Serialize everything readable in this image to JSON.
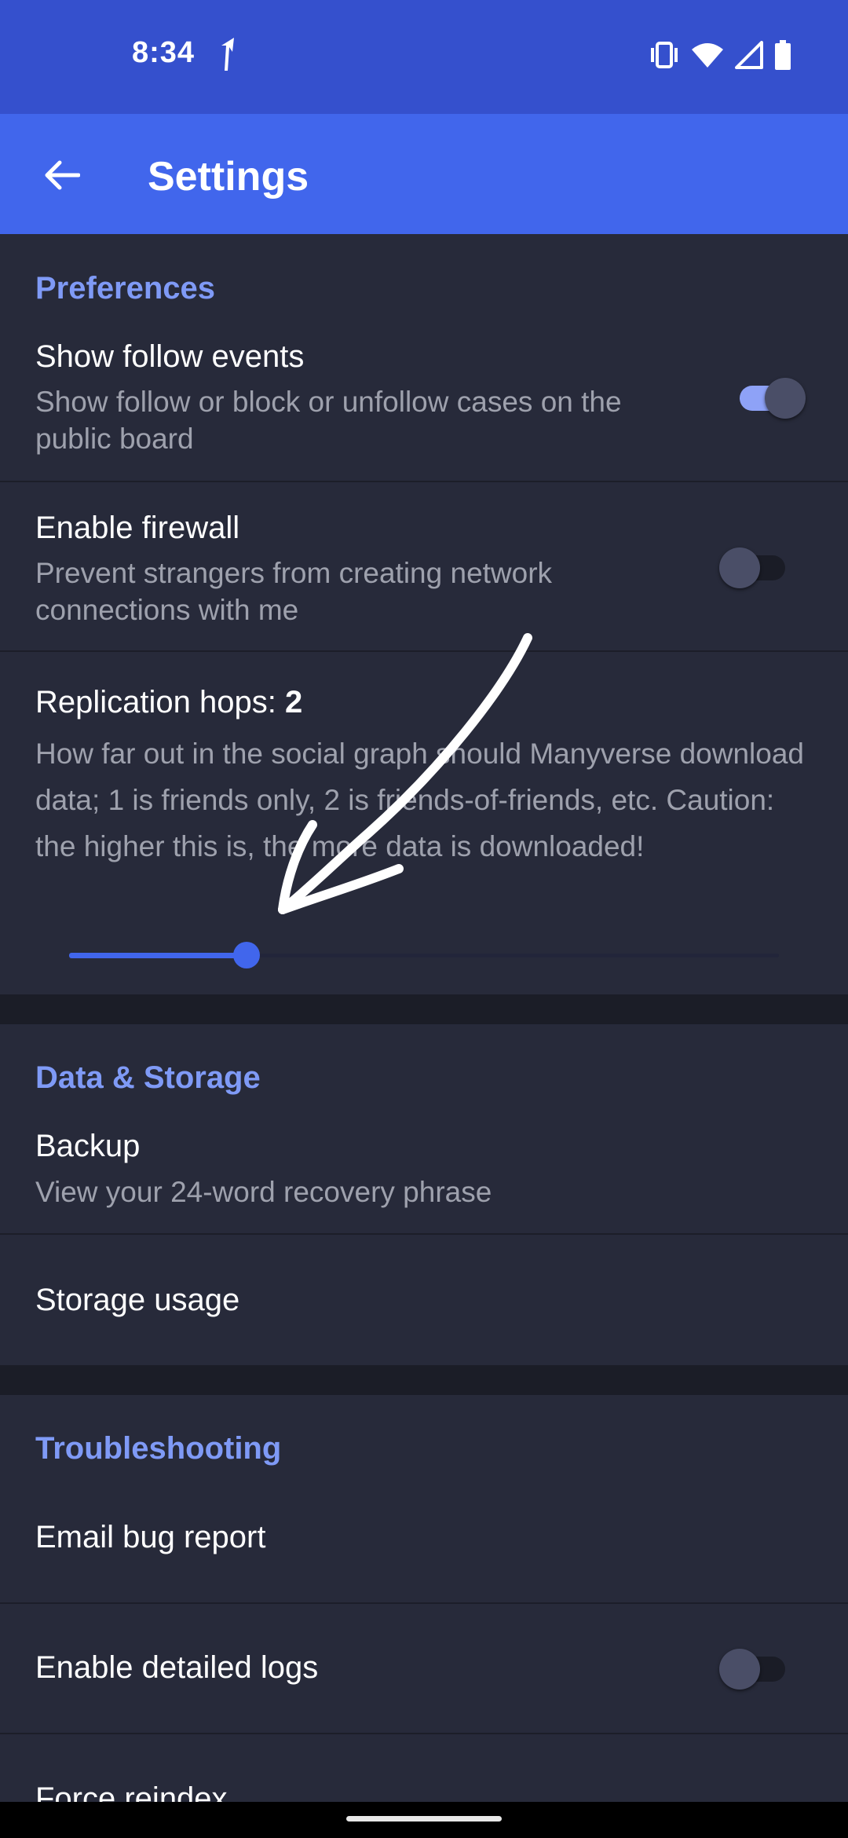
{
  "status": {
    "time": "8:34"
  },
  "app_bar": {
    "title": "Settings"
  },
  "preferences": {
    "header": "Preferences",
    "follow_events": {
      "title": "Show follow events",
      "subtitle": "Show follow or block or unfollow cases on the public board",
      "enabled": true
    },
    "firewall": {
      "title": "Enable firewall",
      "subtitle": "Prevent strangers from creating network connections with me",
      "enabled": false
    },
    "hops": {
      "label": "Replication hops: ",
      "value": "2",
      "description": "How far out in the social graph should Manyverse download data; 1 is friends only, 2 is friends-of-friends, etc. Caution: the higher this is, the more data is downloaded!",
      "slider_fraction": 0.25
    }
  },
  "data_storage": {
    "header": "Data & Storage",
    "backup": {
      "title": "Backup",
      "subtitle": "View your 24-word recovery phrase"
    },
    "storage_usage": {
      "title": "Storage usage"
    }
  },
  "troubleshooting": {
    "header": "Troubleshooting",
    "email_bug_report": {
      "title": "Email bug report"
    },
    "detailed_logs": {
      "title": "Enable detailed logs",
      "enabled": false
    },
    "force_reindex": {
      "title": "Force reindex"
    }
  },
  "colors": {
    "status_bar": "#3550cd",
    "app_bar": "#4166ec",
    "background": "#272a3a",
    "accent_text": "#7f9af6"
  }
}
